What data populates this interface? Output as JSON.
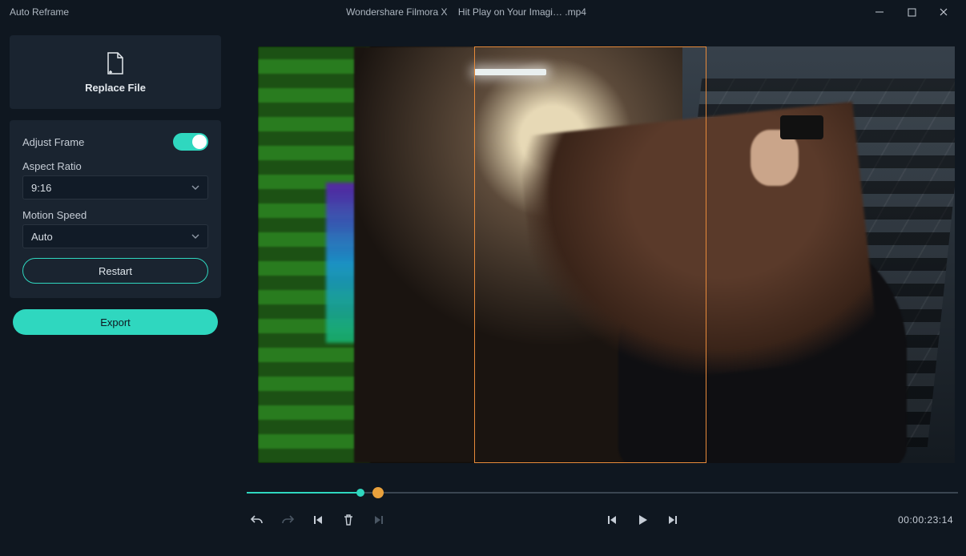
{
  "titlebar": {
    "feature": "Auto Reframe",
    "app": "Wondershare Filmora X",
    "file": "Hit Play on Your Imagi… .mp4"
  },
  "sidebar": {
    "replace_label": "Replace File",
    "adjust_frame_label": "Adjust Frame",
    "adjust_frame_on": true,
    "aspect_ratio_label": "Aspect Ratio",
    "aspect_ratio_value": "9:16",
    "motion_speed_label": "Motion Speed",
    "motion_speed_value": "Auto",
    "restart_label": "Restart",
    "export_label": "Export"
  },
  "playback": {
    "progress_pct": 16,
    "playhead_pct": 18.5,
    "timecode": "00:00:23:14"
  },
  "icons": {
    "undo": "undo-icon",
    "redo": "redo-icon",
    "prev_frame": "prev-frame-icon",
    "delete": "trash-icon",
    "next_cut": "next-cut-icon",
    "step_back": "step-back-icon",
    "play": "play-icon",
    "step_fwd": "step-forward-icon"
  }
}
